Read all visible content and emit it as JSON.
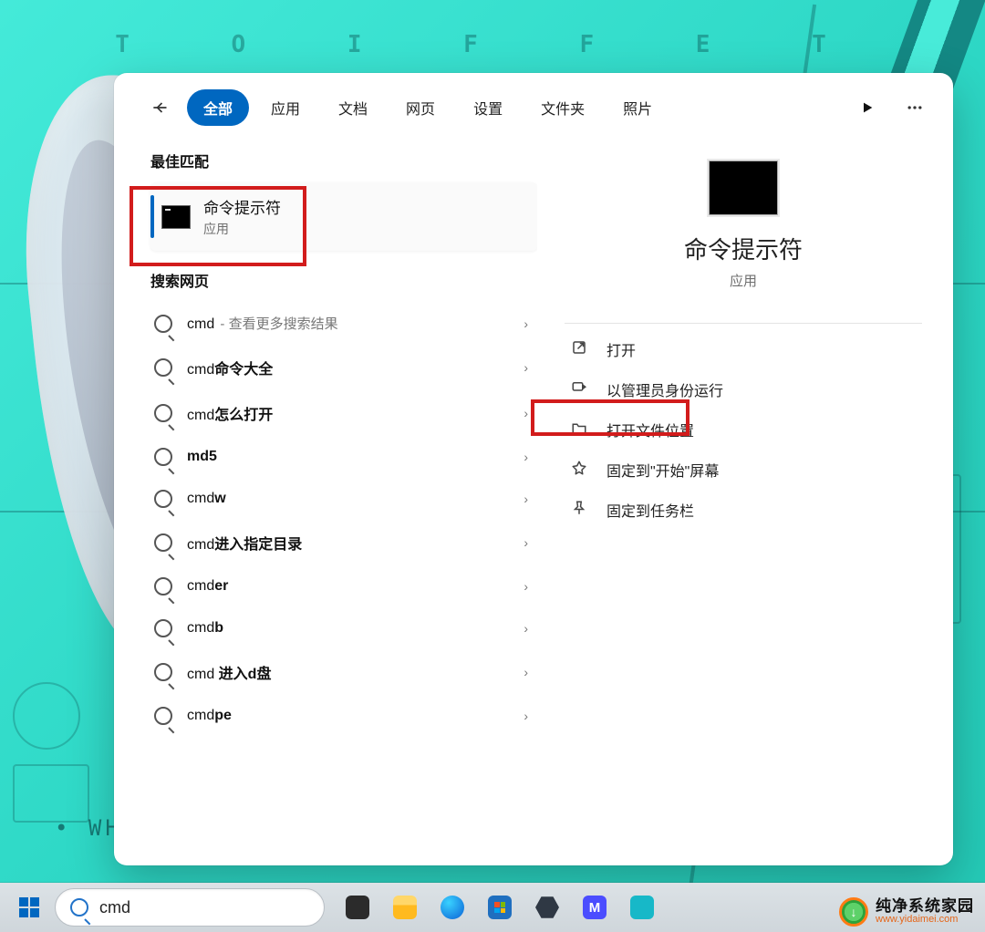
{
  "wallpaper": {
    "top_row_letters": "T O I F F E T",
    "bottom_tag": "• WH"
  },
  "window": {
    "tabs": {
      "all": "全部",
      "apps": "应用",
      "docs": "文档",
      "web": "网页",
      "settings": "设置",
      "folders": "文件夹",
      "photos": "照片"
    },
    "left": {
      "best_match_label": "最佳匹配",
      "best_match": {
        "title": "命令提示符",
        "subtitle": "应用"
      },
      "search_web_label": "搜索网页",
      "items": [
        {
          "prefix": "cmd",
          "bold": "",
          "suffix": " - 查看更多搜索结果"
        },
        {
          "prefix": "cmd",
          "bold": "命令大全",
          "suffix": ""
        },
        {
          "prefix": "cmd",
          "bold": "怎么打开",
          "suffix": ""
        },
        {
          "prefix": "",
          "bold": "md5",
          "suffix": ""
        },
        {
          "prefix": "cmd",
          "bold": "w",
          "suffix": ""
        },
        {
          "prefix": "cmd",
          "bold": "进入指定目录",
          "suffix": ""
        },
        {
          "prefix": "cmd",
          "bold": "er",
          "suffix": ""
        },
        {
          "prefix": "cmd",
          "bold": "b",
          "suffix": ""
        },
        {
          "prefix": "cmd ",
          "bold": "进入d盘",
          "suffix": ""
        },
        {
          "prefix": "cmd",
          "bold": "pe",
          "suffix": ""
        }
      ]
    },
    "right": {
      "title": "命令提示符",
      "subtitle": "应用",
      "actions": {
        "open": "打开",
        "run_admin": "以管理员身份运行",
        "open_location": "打开文件位置",
        "pin_start": "固定到\"开始\"屏幕",
        "pin_taskbar": "固定到任务栏"
      }
    }
  },
  "taskbar": {
    "search_value": "cmd"
  },
  "watermark": {
    "main": "纯净系统家园",
    "sub": "www.yidaimei.com"
  }
}
